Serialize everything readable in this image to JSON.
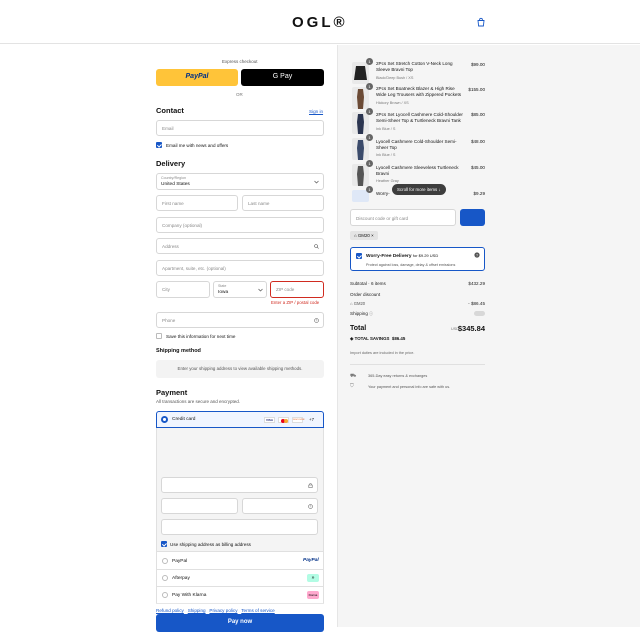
{
  "header": {
    "logo": "OGL®"
  },
  "express": {
    "title": "Express checkout",
    "paypal": "PayPal",
    "gpay": "G Pay",
    "or": "OR"
  },
  "contact": {
    "heading": "Contact",
    "sign_in": "Sign in",
    "email_placeholder": "Email",
    "news_label": "Email me with news and offers"
  },
  "delivery": {
    "heading": "Delivery",
    "country_label": "Country/Region",
    "country_value": "United States",
    "first_name": "First name",
    "last_name": "Last name",
    "company": "Company (optional)",
    "address": "Address",
    "apartment": "Apartment, suite, etc. (optional)",
    "city": "City",
    "state_label": "State",
    "state_value": "Iowa",
    "zip": "ZIP code",
    "zip_error": "Enter a ZIP / postal code",
    "phone": "Phone",
    "save_label": "Save this information for next time"
  },
  "shipping_method": {
    "heading": "Shipping method",
    "note": "Enter your shipping address to view available shipping methods."
  },
  "payment": {
    "heading": "Payment",
    "subtitle": "All transactions are secure and encrypted.",
    "credit_card": "Credit card",
    "cards": [
      "VISA",
      "MC",
      "DISCOVER"
    ],
    "more_cards": "+7",
    "billing_label": "Use shipping address as billing address",
    "options": [
      {
        "label": "PayPal",
        "badge": "PayPal"
      },
      {
        "label": "Afterpay",
        "badge": "»"
      },
      {
        "label": "Pay With Klarna",
        "badge": "Klarna"
      }
    ],
    "pay_now": "Pay now"
  },
  "footer_links": [
    "Refund policy",
    "Shipping",
    "Privacy policy",
    "Terms of service"
  ],
  "cart": {
    "items": [
      {
        "qty": "1",
        "name": "2Pcs Set Stretch Cotton V-Neck Long Sleeve Bravni Top",
        "variant": "Black/Deep Bush / XS",
        "price": "$99.00"
      },
      {
        "qty": "1",
        "name": "2Pcs Set Boatneck Blazer & High Rise Wide Leg Trousers with Zippered Pockets",
        "variant": "Hickory Brown / XS",
        "price": "$155.00"
      },
      {
        "qty": "1",
        "name": "2Pcs Set Lyocell Cashmere Cold-Shoulder Semi-Sheer Top & Turtleneck Bravni Tank",
        "variant": "Ink Blue / S",
        "price": "$85.00"
      },
      {
        "qty": "1",
        "name": "Lyocell Cashmere Cold-Shoulder Semi-Sheer Top",
        "variant": "Ink Blue / S",
        "price": "$48.00"
      },
      {
        "qty": "1",
        "name": "Lyocell Cashmere Sleeveless Turtleneck Bravni",
        "variant": "Heather Gray",
        "price": "$45.00"
      },
      {
        "qty": "1",
        "name": "Worry-Free Delivery",
        "variant": "",
        "price": "$9.29"
      }
    ],
    "scroll_hint": "Scroll for more items",
    "discount_placeholder": "Discount code or gift card",
    "code_tag": "GM20",
    "worry": {
      "title": "Worry-Free Delivery",
      "price": "for $9.29 USD",
      "desc": "Protect against loss, damage, delay & offset emissions"
    },
    "subtotal_label": "Subtotal · 6 items",
    "subtotal_value": "$432.29",
    "order_discount": "Order discount",
    "discount_code": "GM20",
    "discount_value": "- $86.45",
    "shipping_label": "Shipping",
    "total_label": "Total",
    "currency": "USD",
    "total_value": "$345.84",
    "savings_label": "TOTAL SAVINGS",
    "savings_value": "$86.45",
    "duties_note": "Import duties are included in the price.",
    "perks": [
      "365-Day easy returns & exchanges",
      "Your payment and personal info are safe with us."
    ]
  },
  "colors": {
    "accent": "#1757c7",
    "paypal": "#ffc439",
    "error": "#d02b20",
    "right_bg": "#f5f5f5"
  }
}
